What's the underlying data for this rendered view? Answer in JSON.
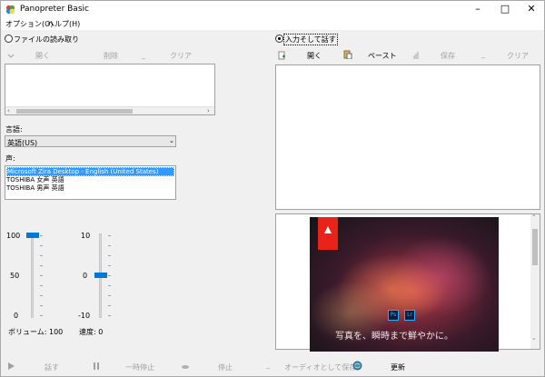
{
  "window": {
    "title": "Panopreter Basic"
  },
  "menu": {
    "options": "オプション(O)",
    "help": "ヘルプ(H)"
  },
  "left": {
    "radio_file": "ファイルの読み取り",
    "toolbar": {
      "open": "開く",
      "delete": "削除",
      "clear": "クリア"
    },
    "language_label": "言語:",
    "language_value": "英語(US)",
    "voice_label": "声:",
    "voices": [
      "Microsoft Zira Desktop - English (United States)",
      "TOSHIBA 女声 英語",
      "TOSHIBA 男声 英語"
    ],
    "volume": {
      "ticks": [
        "100",
        "50",
        "0"
      ],
      "label": "ボリューム: 100",
      "value": 100
    },
    "speed": {
      "ticks": [
        "10",
        "0",
        "-10"
      ],
      "label": "速度: 0",
      "value": 0
    }
  },
  "right": {
    "radio_input": "入力そして話す",
    "toolbar": {
      "open": "開く",
      "paste": "ペースト",
      "save": "保存",
      "clear": "クリア"
    }
  },
  "ad": {
    "caption": "写真を、瞬時まで鮮やかに。",
    "ps": "Ps",
    "lr": "Lr"
  },
  "bottom": {
    "speak": "話す",
    "pause": "一時停止",
    "stop": "停止",
    "save_audio": "オーディオとして保存",
    "update": "更新"
  },
  "colors": {
    "accent": "#0078d7",
    "selection": "#3399ff",
    "adobe_red": "#e8241a"
  }
}
